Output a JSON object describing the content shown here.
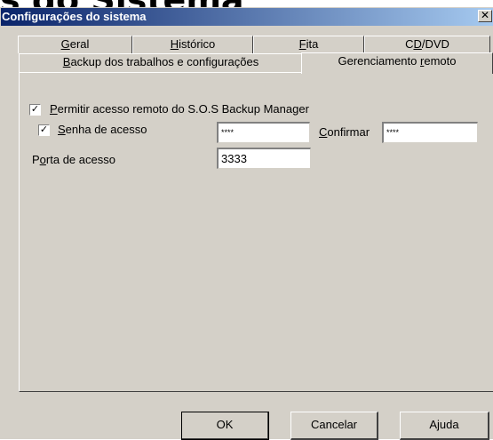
{
  "background_title": "s do Sistema",
  "window": {
    "title": "Configurações do sistema",
    "close_glyph": "✕"
  },
  "tabs_row1": [
    {
      "pre": "",
      "key": "G",
      "post": "eral"
    },
    {
      "pre": "",
      "key": "H",
      "post": "istórico"
    },
    {
      "pre": "",
      "key": "F",
      "post": "ita"
    },
    {
      "pre": "C",
      "key": "D",
      "post": "/DVD"
    }
  ],
  "tabs_row2": [
    {
      "pre": "",
      "key": "B",
      "post": "ackup dos trabalhos e configurações"
    },
    {
      "pre": "Gerenciamento ",
      "key": "r",
      "post": "emoto",
      "selected": true
    }
  ],
  "panel": {
    "remote_access": {
      "checked": true,
      "check_glyph": "✓",
      "key": "P",
      "post": "ermitir acesso remoto do S.O.S Backup Manager"
    },
    "password": {
      "checked": true,
      "check_glyph": "✓",
      "key": "S",
      "post": "enha de acesso",
      "value": "****"
    },
    "confirm": {
      "key": "C",
      "post": "onfirmar",
      "value": "****"
    },
    "port": {
      "pre": "P",
      "key": "o",
      "post": "rta de acesso",
      "value": "3333"
    }
  },
  "buttons": {
    "ok": "OK",
    "cancel": "Cancelar",
    "help": "Ajuda"
  },
  "colors": {
    "dialog_bg": "#d4d0c8",
    "titlebar_start": "#0a246a",
    "titlebar_end": "#a6caf0"
  }
}
